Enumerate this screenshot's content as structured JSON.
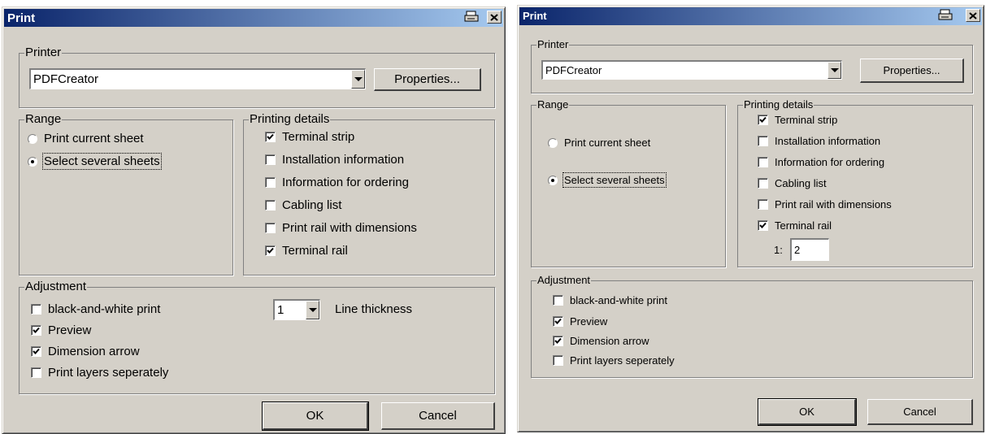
{
  "dialog1": {
    "title": "Print",
    "printer": {
      "legend": "Printer",
      "selected": "PDFCreator",
      "properties_label": "Properties..."
    },
    "range": {
      "legend": "Range",
      "options": [
        {
          "label": "Print current sheet",
          "selected": false
        },
        {
          "label": "Select several sheets",
          "selected": true
        }
      ]
    },
    "details": {
      "legend": "Printing details",
      "items": [
        {
          "label": "Terminal strip",
          "checked": true
        },
        {
          "label": "Installation information",
          "checked": false
        },
        {
          "label": "Information for ordering",
          "checked": false
        },
        {
          "label": "Cabling list",
          "checked": false
        },
        {
          "label": "Print rail with dimensions",
          "checked": false
        },
        {
          "label": "Terminal rail",
          "checked": true
        }
      ]
    },
    "adjustment": {
      "legend": "Adjustment",
      "items": [
        {
          "label": "black-and-white print",
          "checked": false
        },
        {
          "label": "Preview",
          "checked": true
        },
        {
          "label": "Dimension arrow",
          "checked": true
        },
        {
          "label": "Print layers seperately",
          "checked": false
        }
      ],
      "line_thickness_value": "1",
      "line_thickness_label": "Line thickness"
    },
    "ok_label": "OK",
    "cancel_label": "Cancel"
  },
  "dialog2": {
    "title": "Print",
    "printer": {
      "legend": "Printer",
      "selected": "PDFCreator",
      "properties_label": "Properties..."
    },
    "range": {
      "legend": "Range",
      "options": [
        {
          "label": "Print current sheet",
          "selected": false
        },
        {
          "label": "Select several sheets",
          "selected": true
        }
      ]
    },
    "details": {
      "legend": "Printing details",
      "items": [
        {
          "label": "Terminal strip",
          "checked": true
        },
        {
          "label": "Installation information",
          "checked": false
        },
        {
          "label": "Information for ordering",
          "checked": false
        },
        {
          "label": "Cabling list",
          "checked": false
        },
        {
          "label": "Print rail with dimensions",
          "checked": false
        },
        {
          "label": "Terminal rail",
          "checked": true
        }
      ],
      "rail_count_label": "1:",
      "rail_count_value": "2"
    },
    "adjustment": {
      "legend": "Adjustment",
      "items": [
        {
          "label": "black-and-white print",
          "checked": false
        },
        {
          "label": "Preview",
          "checked": true
        },
        {
          "label": "Dimension arrow",
          "checked": true
        },
        {
          "label": "Print layers seperately",
          "checked": false
        }
      ]
    },
    "ok_label": "OK",
    "cancel_label": "Cancel"
  }
}
